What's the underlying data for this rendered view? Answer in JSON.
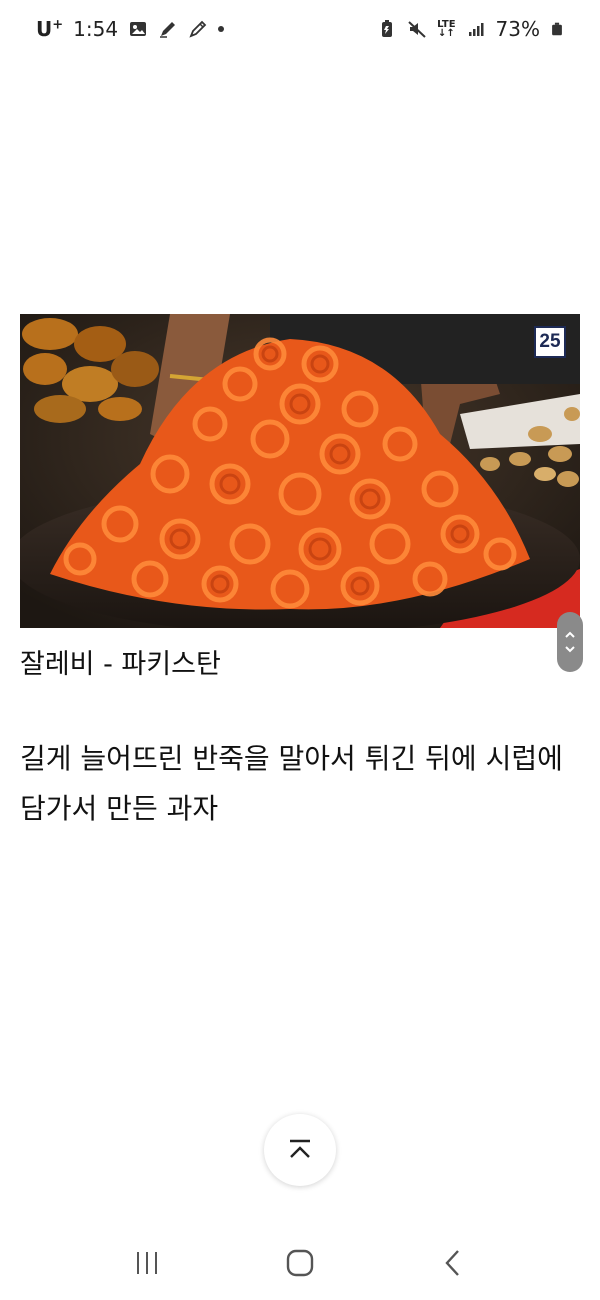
{
  "status_bar": {
    "carrier": "U",
    "carrier_plus": "+",
    "time": "1:54",
    "network": "LTE",
    "battery": "73%"
  },
  "post": {
    "image_count": "25",
    "caption": "잘레비 - 파키스탄",
    "description": "길게 늘어뜨린 반죽을 말아서 튀긴 뒤에 시럽에 담가서 만든 과자"
  },
  "icons": {
    "gallery": "gallery-icon",
    "edit": "pencil-icon",
    "mute": "mute-icon",
    "signal": "signal-icon",
    "battery": "battery-icon",
    "scroll_top": "chevron-up-icon",
    "recents": "recents-icon",
    "home": "home-icon",
    "back": "back-icon"
  },
  "colors": {
    "badge_border": "#1d2a55",
    "jalebi_orange": "#f26a1b",
    "scroll_pill": "#8a8a8a"
  }
}
